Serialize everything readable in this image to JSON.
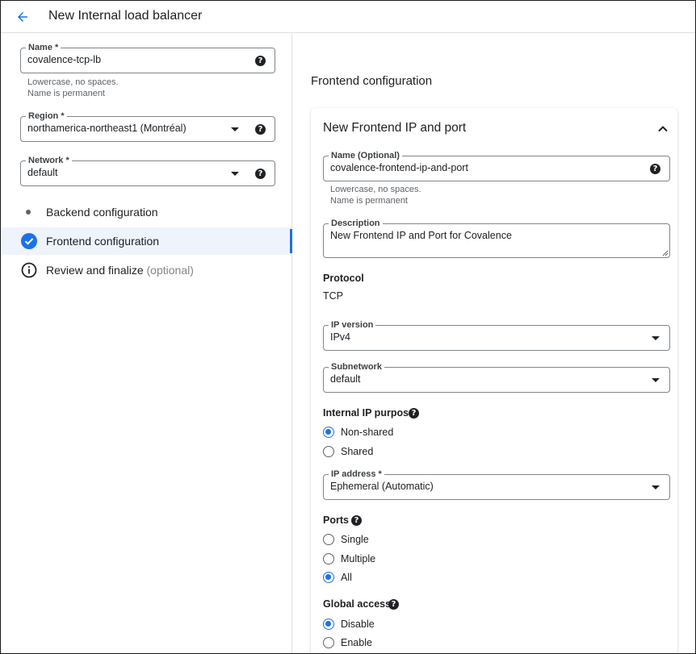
{
  "header": {
    "title": "New Internal load balancer",
    "back_icon": "arrow-left-icon"
  },
  "left": {
    "name_field": {
      "label": "Name *",
      "value": "covalence-tcp-lb",
      "hint1": "Lowercase, no spaces.",
      "hint2": "Name is permanent"
    },
    "region_field": {
      "label": "Region *",
      "value": "northamerica-northeast1 (Montréal)"
    },
    "network_field": {
      "label": "Network *",
      "value": "default"
    },
    "steps": [
      {
        "label": "Backend configuration",
        "optional": "",
        "state": "pending"
      },
      {
        "label": "Frontend configuration",
        "optional": "",
        "state": "done"
      },
      {
        "label": "Review and finalize",
        "optional": " (optional)",
        "state": "info"
      }
    ]
  },
  "right": {
    "section_title": "Frontend configuration",
    "card": {
      "title": "New Frontend IP and port",
      "name_field": {
        "label": "Name (Optional)",
        "value": "covalence-frontend-ip-and-port",
        "hint1": "Lowercase, no spaces.",
        "hint2": "Name is permanent"
      },
      "description_field": {
        "label": "Description",
        "value": "New Frontend IP and Port for Covalence"
      },
      "protocol_label": "Protocol",
      "protocol_value": "TCP",
      "ip_version_field": {
        "label": "IP version",
        "value": "IPv4"
      },
      "subnetwork_field": {
        "label": "Subnetwork",
        "value": "default"
      },
      "internal_ip_purpose": {
        "label": "Internal IP purpose",
        "options": [
          "Non-shared",
          "Shared"
        ],
        "selected": "Non-shared"
      },
      "ip_address_field": {
        "label": "IP address *",
        "value": "Ephemeral (Automatic)"
      },
      "ports": {
        "label": "Ports",
        "options": [
          "Single",
          "Multiple",
          "All"
        ],
        "selected": "All"
      },
      "global_access": {
        "label": "Global access",
        "options": [
          "Disable",
          "Enable"
        ],
        "selected": "Disable"
      }
    }
  },
  "colors": {
    "accent": "#1a73e8",
    "active_step_bg": "#eef3fc",
    "border": "#80868b"
  }
}
